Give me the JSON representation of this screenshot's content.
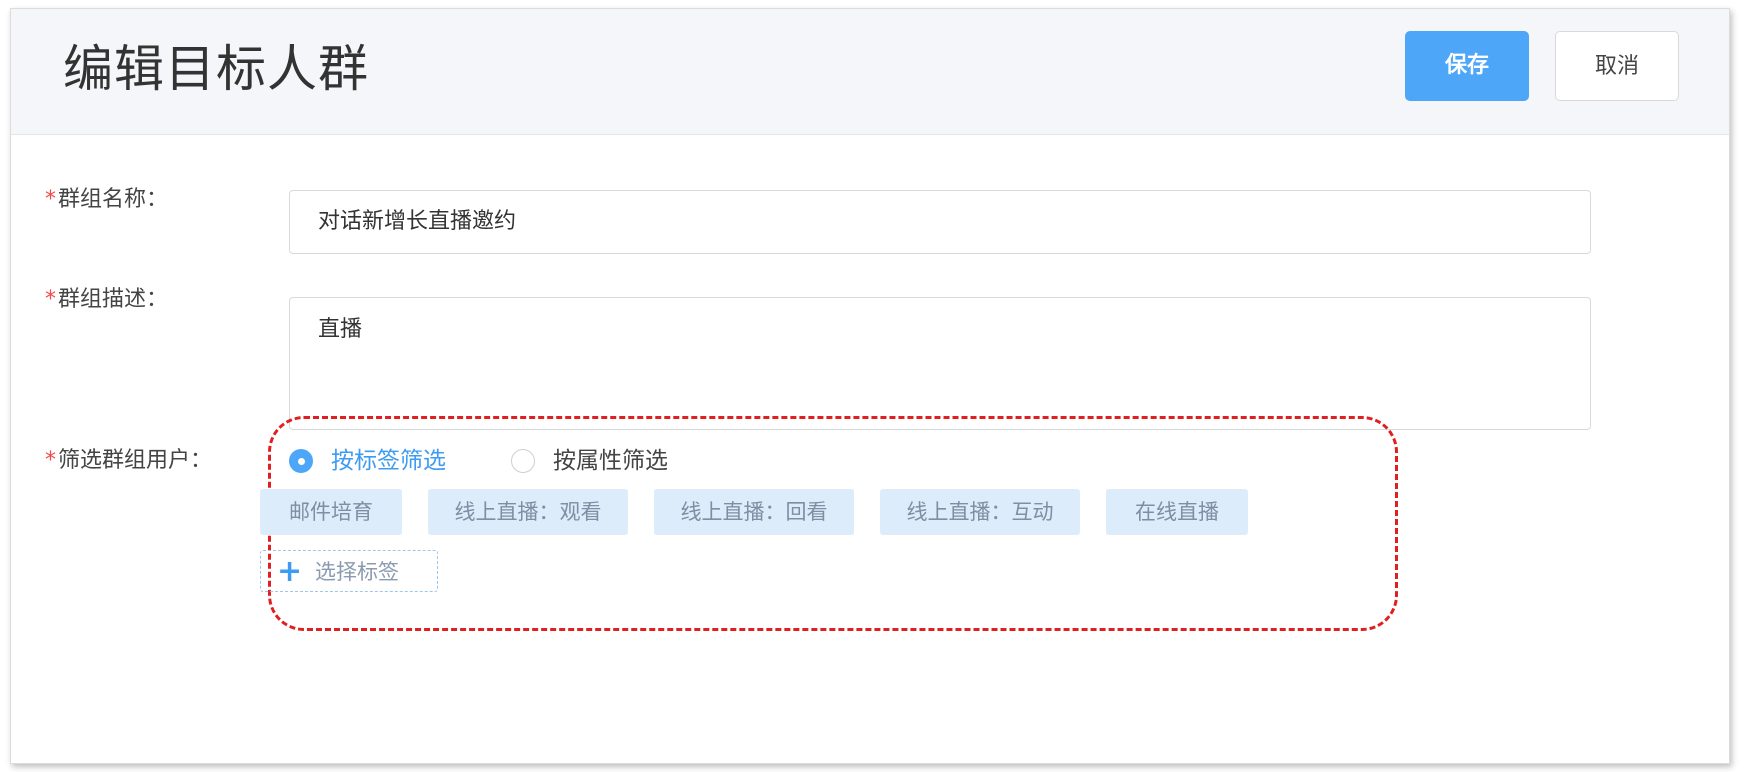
{
  "header": {
    "title": "编辑目标人群",
    "save_label": "保存",
    "cancel_label": "取消"
  },
  "form": {
    "required_mark": "*",
    "name": {
      "label": "群组名称：",
      "value": "对话新增长直播邀约"
    },
    "description": {
      "label": "群组描述：",
      "value": "直播"
    },
    "filter": {
      "label": "筛选群组用户：",
      "options": [
        {
          "label": "按标签筛选",
          "checked": true
        },
        {
          "label": "按属性筛选",
          "checked": false
        }
      ],
      "tags": [
        "邮件培育",
        "线上直播：观看",
        "线上直播：回看",
        "线上直播：互动",
        "在线直播"
      ],
      "add_tag_label": "选择标签",
      "add_tag_icon": "plus-icon"
    }
  },
  "colors": {
    "primary": "#4da6f7",
    "required": "#f04a4a",
    "highlight": "#e02020",
    "tag_bg": "#dcecfb"
  }
}
